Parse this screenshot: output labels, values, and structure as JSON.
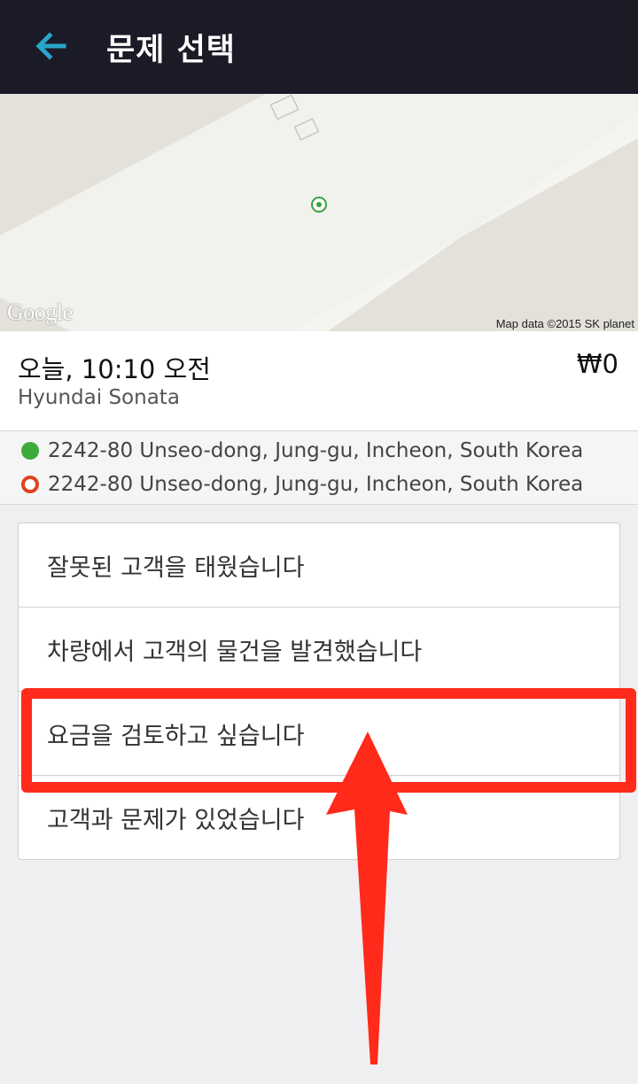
{
  "header": {
    "title": "문제 선택"
  },
  "map": {
    "logo": "Google",
    "credit": "Map data ©2015 SK planet"
  },
  "trip": {
    "time": "오늘, 10:10 오전",
    "fare": "₩0",
    "vehicle": "Hyundai Sonata",
    "pickup": "2242-80 Unseo-dong, Jung-gu, Incheon, South Korea",
    "dropoff": "2242-80 Unseo-dong, Jung-gu, Incheon, South Korea"
  },
  "options": [
    {
      "label": "잘못된 고객을 태웠습니다"
    },
    {
      "label": "차량에서 고객의 물건을 발견했습니다"
    },
    {
      "label": "요금을 검토하고 싶습니다"
    },
    {
      "label": "고객과 문제가 있었습니다"
    }
  ],
  "colors": {
    "header_bg": "#1a1b26",
    "accent_back": "#29a6c9",
    "highlight": "#ff2a1a",
    "pickup_dot": "#3dab3a",
    "dropoff_ring": "#e0421f"
  }
}
